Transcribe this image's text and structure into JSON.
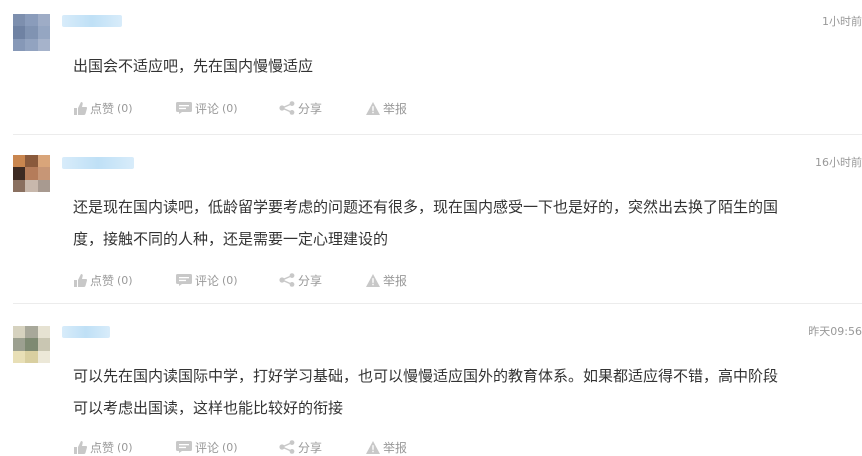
{
  "comments": [
    {
      "time": "1小时前",
      "text": "出国会不适应吧，先在国内慢慢适应",
      "like_label": "点赞",
      "like_count": "(0)",
      "reply_label": "评论",
      "reply_count": "(0)",
      "share_label": "分享",
      "report_label": "举报"
    },
    {
      "time": "16小时前",
      "text_line1": "还是现在国内读吧，低龄留学要考虑的问题还有很多，现在国内感受一下也是好的，突然出去换了陌生的国",
      "text_line2": "度，接触不同的人种，还是需要一定心理建设的",
      "like_label": "点赞",
      "like_count": "(0)",
      "reply_label": "评论",
      "reply_count": "(0)",
      "share_label": "分享",
      "report_label": "举报"
    },
    {
      "time": "昨天09:56",
      "text_line1": "可以先在国内读国际中学，打好学习基础，也可以慢慢适应国外的教育体系。如果都适应得不错，高中阶段",
      "text_line2": "可以考虑出国读，这样也能比较好的衔接",
      "like_label": "点赞",
      "like_count": "(0)",
      "reply_label": "评论",
      "reply_count": "(0)",
      "share_label": "分享",
      "report_label": "举报"
    }
  ],
  "icons": {
    "like": "thumbs-up-icon",
    "reply": "comment-icon",
    "share": "share-icon",
    "report": "warning-icon"
  },
  "colors": {
    "muted": "#999999",
    "text": "#333333",
    "divider": "#ececec",
    "name_blur": "#bfe0f6"
  }
}
